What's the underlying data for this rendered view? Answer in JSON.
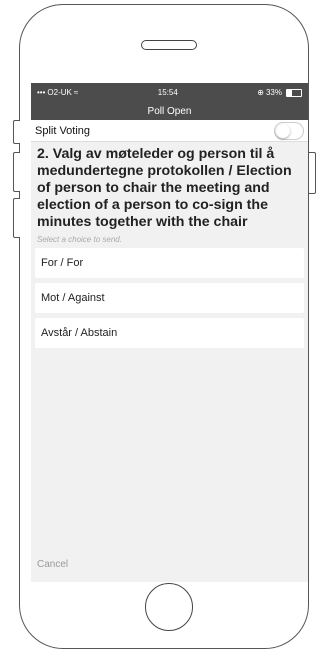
{
  "statusbar": {
    "carrier": "O2-UK",
    "time": "15:54",
    "battery": "33%"
  },
  "header": {
    "title": "Poll Open"
  },
  "split_voting": {
    "label": "Split Voting",
    "enabled": false
  },
  "poll": {
    "question": "2. Valg av møteleder og person til å medundertegne protokollen / Election of person to chair the meeting and election of a person to co-sign the minutes together with the chair",
    "hint": "Select a choice to send.",
    "choices": [
      {
        "label": "For / For"
      },
      {
        "label": "Mot / Against"
      },
      {
        "label": "Avstår / Abstain"
      }
    ]
  },
  "footer": {
    "cancel_label": "Cancel"
  }
}
